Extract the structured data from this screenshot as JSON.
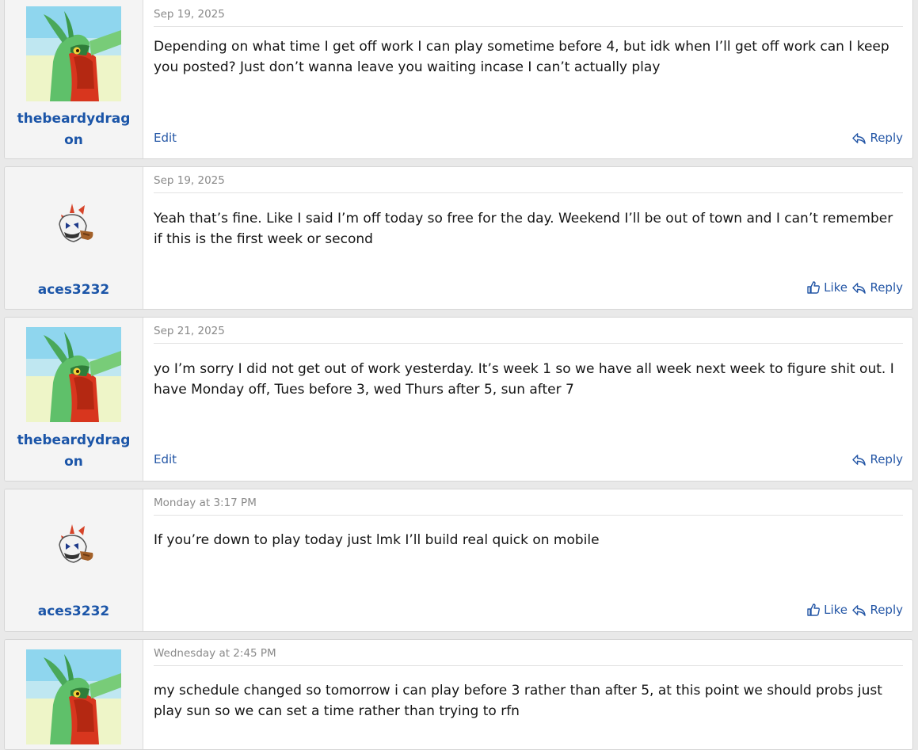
{
  "colors": {
    "link": "#1b55a8",
    "background": "#e9e9e9",
    "user_column": "#f4f4f4"
  },
  "icons": {
    "like": "thumbs-up-icon",
    "reply": "reply-arrow-icon"
  },
  "posts": [
    {
      "username": "thebeardydragon",
      "avatar": "green-dragon-avatar",
      "date": "Sep 19, 2025",
      "body": "Depending on what time I get off work I can play sometime before 4, but idk when I’ll get off work can I keep you posted? Just don’t wanna leave you waiting incase I can’t actually play",
      "edit_label": "Edit",
      "reply_label": "Reply"
    },
    {
      "username": "aces3232",
      "avatar": "white-skull-sprite-avatar",
      "date": "Sep 19, 2025",
      "body": "Yeah that’s fine. Like I said I’m off today so free for the day. Weekend I’ll be out of town and I can’t remember if this is the first week or second",
      "like_label": "Like",
      "reply_label": "Reply"
    },
    {
      "username": "thebeardydragon",
      "avatar": "green-dragon-avatar",
      "date": "Sep 21, 2025",
      "body": "yo I’m sorry I did not get out of work yesterday. It’s week 1 so we have all week next week to figure shit out. I have Monday off, Tues before 3, wed Thurs after 5, sun after 7",
      "edit_label": "Edit",
      "reply_label": "Reply"
    },
    {
      "username": "aces3232",
      "avatar": "white-skull-sprite-avatar",
      "date": "Monday at 3:17 PM",
      "body": "If you’re down to play today just lmk I’ll build real quick on mobile",
      "like_label": "Like",
      "reply_label": "Reply"
    },
    {
      "username": "thebeardydragon",
      "avatar": "green-dragon-avatar",
      "date": "Wednesday at 2:45 PM",
      "body": "my schedule changed so tomorrow i can play before 3 rather than after 5, at this point we should probs just play sun so we can set a time rather than trying to rfn"
    }
  ]
}
